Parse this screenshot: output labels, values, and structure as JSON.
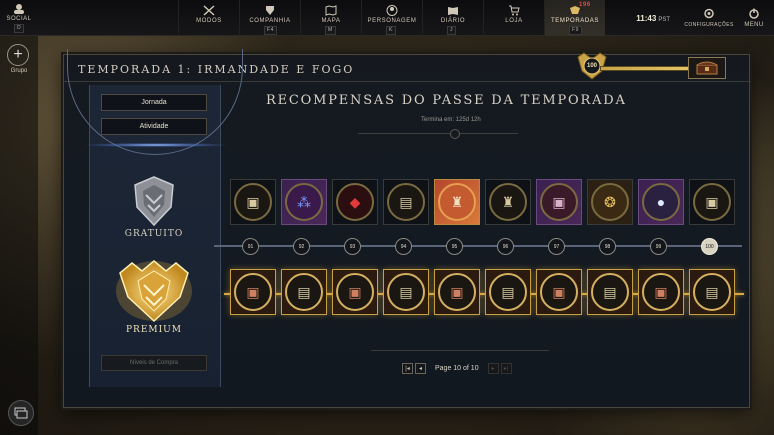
{
  "topbar": {
    "social": {
      "label": "SOCIAL",
      "key": "O"
    },
    "nav": [
      {
        "label": "MODOS",
        "key": "",
        "icon": "swords-icon",
        "active": false
      },
      {
        "label": "COMPANHIA",
        "key": "F4",
        "icon": "shield-icon",
        "active": false
      },
      {
        "label": "MAPA",
        "key": "M",
        "icon": "map-icon",
        "active": false
      },
      {
        "label": "PERSONAGEM",
        "key": "K",
        "icon": "person-icon",
        "active": false
      },
      {
        "label": "DIÁRIO",
        "key": "J",
        "icon": "book-icon",
        "active": false
      },
      {
        "label": "LOJA",
        "key": "",
        "icon": "cart-icon",
        "active": false
      },
      {
        "label": "TEMPORADAS",
        "key": "F9",
        "icon": "season-icon",
        "active": true,
        "badge": "196"
      }
    ],
    "time": "11:43",
    "timezone": "PST",
    "settings_label": "CONFIGURAÇÕES",
    "menu_label": "MENU"
  },
  "sidebar": {
    "group_label": "Grupo"
  },
  "window": {
    "title": "TEMPORADA 1: IRMANDADE E FOGO",
    "level": "100"
  },
  "left": {
    "tab_journey": "Jornada",
    "tab_activity": "Atividade",
    "free_label": "GRATUITO",
    "premium_label": "PREMIUM",
    "purchase_label": "Níveis de Compra"
  },
  "main": {
    "heading": "RECOMPENSAS DO PASSE DA TEMPORADA",
    "ends": "Termina em: 125d 12h",
    "levels": [
      "91",
      "92",
      "93",
      "94",
      "95",
      "96",
      "97",
      "98",
      "99",
      "100"
    ],
    "free_rewards": [
      "chest-icon",
      "potion-bundle-icon",
      "gem-icon",
      "chest-icon",
      "armor-icon",
      "armor-icon",
      "chest-icon",
      "coins-icon",
      "pearl-icon",
      "chest-icon"
    ],
    "premium_rewards": [
      "chest-icon",
      "chest-icon",
      "chest-icon",
      "chest-icon",
      "chest-icon",
      "chest-icon",
      "chest-icon",
      "chest-icon",
      "chest-icon",
      "chest-icon"
    ],
    "pager": {
      "text": "Page 10 of 10"
    }
  },
  "colors": {
    "gold": "#d8a940",
    "panel": "#1c2636",
    "accent_blue": "#9fc0ff"
  }
}
